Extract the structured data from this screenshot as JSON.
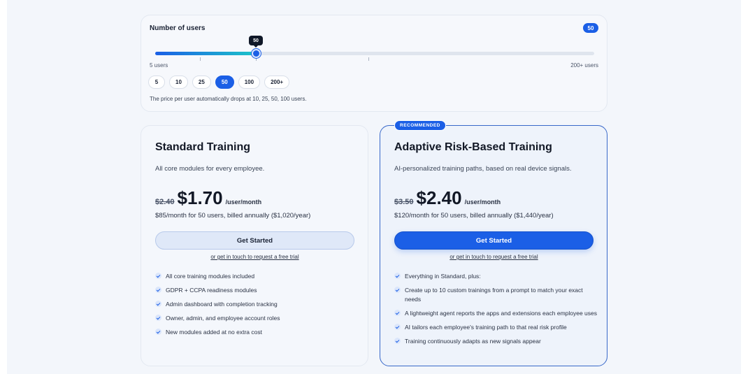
{
  "user_selector": {
    "title": "Number of users",
    "selected_value": "50",
    "tooltip": "50",
    "slider_min_label": "5 users",
    "slider_max_label": "200+ users",
    "slider_fraction": 0.23,
    "presets": [
      "5",
      "10",
      "25",
      "50",
      "100",
      "200+"
    ],
    "active_preset": "50",
    "note": "The price per user automatically drops at 10, 25, 50, 100 users."
  },
  "plans": [
    {
      "title": "Standard Training",
      "description": "All core modules for every employee.",
      "old_price": "$2.40",
      "price": "$1.70",
      "unit": "/user/month",
      "billing": "$85/month for 50 users, billed annually ($1,020/year)",
      "cta": "Get Started",
      "trial_link": "or get in touch to request a free trial",
      "features": [
        "All core training modules included",
        "GDPR + CCPA readiness modules",
        "Admin dashboard with completion tracking",
        "Owner, admin, and employee account roles",
        "New modules added at no extra cost"
      ]
    },
    {
      "badge": "RECOMMENDED",
      "title": "Adaptive Risk-Based Training",
      "description": "AI-personalized training paths, based on real device signals.",
      "old_price": "$3.50",
      "price": "$2.40",
      "unit": "/user/month",
      "billing": "$120/month for 50 users, billed annually ($1,440/year)",
      "cta": "Get Started",
      "trial_link": "or get in touch to request a free trial",
      "features": [
        "Everything in Standard, plus:",
        "Create up to 10 custom trainings from a prompt to match your exact needs",
        "A lightweight agent reports the apps and extensions each employee uses",
        "AI tailors each employee's training path to that real risk profile",
        "Training continuously adapts as new signals appear"
      ]
    }
  ],
  "colors": {
    "accent": "#1b5fe6",
    "slider_gradient_end": "#1cc4c9",
    "background": "#f3f6fb"
  },
  "icons": {
    "feature_check": "check-circle-icon"
  }
}
